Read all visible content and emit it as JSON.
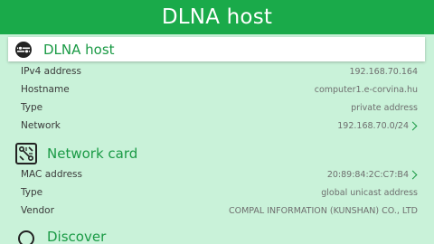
{
  "title": "DLNA host",
  "sections": {
    "host": {
      "title": "DLNA host",
      "icon": "dlna-icon",
      "rows": [
        {
          "label": "IPv4 address",
          "value": "192.168.70.164"
        },
        {
          "label": "Hostname",
          "value": "computer1.e-corvina.hu"
        },
        {
          "label": "Type",
          "value": "private address"
        },
        {
          "label": "Network",
          "value": "192.168.70.0/24"
        }
      ]
    },
    "card": {
      "title": "Network card",
      "icon": "network-card-icon",
      "rows": [
        {
          "label": "MAC address",
          "value": "20:89:84:2C:C7:B4"
        },
        {
          "label": "Type",
          "value": "global unicast address"
        },
        {
          "label": "Vendor",
          "value": "COMPAL INFORMATION (KUNSHAN) CO., LTD"
        }
      ]
    },
    "discover": {
      "title": "Discover",
      "icon": "discover-icon"
    }
  },
  "colors": {
    "accent": "#1aaa4a",
    "background": "#c9f2d9",
    "section_title": "#1a9a45"
  }
}
